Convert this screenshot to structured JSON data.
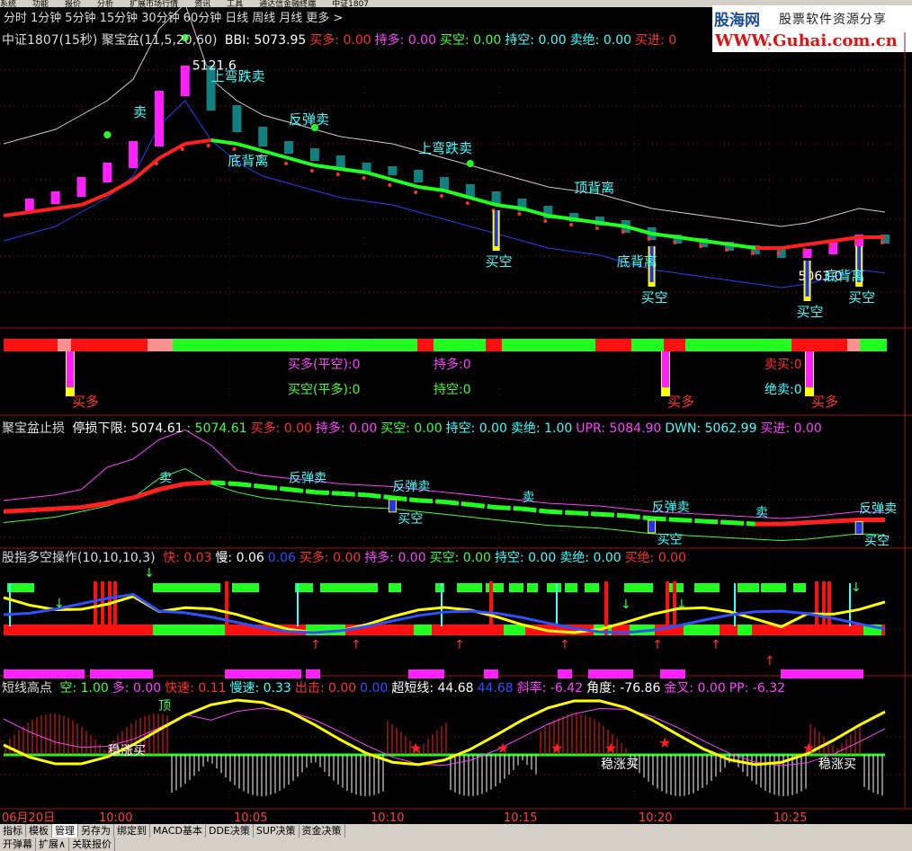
{
  "menu": [
    "系统",
    "功能",
    "报价",
    "分析",
    "扩展市场行情",
    "资讯",
    "工具",
    "通达信金融终端",
    "中证1807"
  ],
  "timeframes": [
    "分时",
    "1分钟",
    "5分钟",
    "15分钟",
    "30分钟",
    "60分钟",
    "日线",
    "周线",
    "月线",
    "更多 >"
  ],
  "logo": {
    "line1": "股海网",
    "line1b": "股票软件资源分享",
    "line2": "WWW.Guhai.com.cn"
  },
  "panel1": {
    "title": "中证1807(15秒) 聚宝盆(11,5,20,60)",
    "fields": [
      {
        "label": "BBI:",
        "value": "5073.95",
        "color": "#ffffff"
      },
      {
        "label": "买多:",
        "value": "0.00",
        "color": "#ff3030"
      },
      {
        "label": "持多:",
        "value": "0.00",
        "color": "#ff40ff"
      },
      {
        "label": "买空:",
        "value": "0.00",
        "color": "#40ff40"
      },
      {
        "label": "持空:",
        "value": "0.00",
        "color": "#40ffff"
      },
      {
        "label": "卖绝:",
        "value": "0.00",
        "color": "#40ffff"
      },
      {
        "label": "买进:",
        "value": "0",
        "color": "#ff3030"
      }
    ],
    "high_label": "5121.6",
    "low_label": "5063.0"
  },
  "panel2": {
    "texts": {
      "buy_long": "买多(平空):0",
      "hold_long": "持多:0",
      "sell_buy": "卖买:0",
      "buy_short": "买空(平多):0",
      "hold_short": "持空:0",
      "sell_sell": "绝卖:0"
    },
    "labels": [
      "买多",
      "买多",
      "买多"
    ]
  },
  "panel3": {
    "title": "聚宝盆止损",
    "fields": [
      {
        "label": "停损下限:",
        "value": "5074.61",
        "color": "#ffffff"
      },
      {
        "label": ":",
        "value": "5074.61",
        "color": "#40ff40"
      },
      {
        "label": "买多:",
        "value": "0.00",
        "color": "#ff3030"
      },
      {
        "label": "持多:",
        "value": "0.00",
        "color": "#ff40ff"
      },
      {
        "label": "买空:",
        "value": "0.00",
        "color": "#40ff40"
      },
      {
        "label": "持空:",
        "value": "0.00",
        "color": "#40ffff"
      },
      {
        "label": "卖绝:",
        "value": "1.00",
        "color": "#40ffff"
      },
      {
        "label": "UPR:",
        "value": "5084.90",
        "color": "#ff40ff"
      },
      {
        "label": "DWN:",
        "value": "5062.99",
        "color": "#40ffff"
      },
      {
        "label": "买进:",
        "value": "0.00",
        "color": "#ff40ff"
      }
    ]
  },
  "panel4": {
    "title": "股指多空操作(10,10,10,3)",
    "fields": [
      {
        "label": "快:",
        "value": "0.03",
        "color": "#ff3030"
      },
      {
        "label": "慢:",
        "value": "0.06",
        "color": "#ffffff"
      },
      {
        "label": "",
        "value": "0.06",
        "color": "#3050ff"
      },
      {
        "label": "买多:",
        "value": "0.00",
        "color": "#ff3030"
      },
      {
        "label": "持多:",
        "value": "0.00",
        "color": "#ff40ff"
      },
      {
        "label": "买空:",
        "value": "0.00",
        "color": "#40ff40"
      },
      {
        "label": "持空:",
        "value": "0.00",
        "color": "#40ffff"
      },
      {
        "label": "卖绝:",
        "value": "0.00",
        "color": "#40ffff"
      },
      {
        "label": "买绝:",
        "value": "0.00",
        "color": "#ff3030"
      }
    ]
  },
  "panel5": {
    "title": "短线高点",
    "fields": [
      {
        "label": "空:",
        "value": "1.00",
        "color": "#40ff40"
      },
      {
        "label": "多:",
        "value": "0.00",
        "color": "#ff40ff"
      },
      {
        "label": "快速:",
        "value": "0.11",
        "color": "#ff3030"
      },
      {
        "label": "慢速:",
        "value": "0.33",
        "color": "#40ffff"
      },
      {
        "label": "出击:",
        "value": "0.00",
        "color": "#ff3030"
      },
      {
        "label": "",
        "value": "0.00",
        "color": "#3050ff"
      },
      {
        "label": "超短线:",
        "value": "44.68",
        "color": "#ffffff"
      },
      {
        "label": "",
        "value": "44.68",
        "color": "#3050ff"
      },
      {
        "label": "斜率:",
        "value": "-6.42",
        "color": "#ff40ff"
      },
      {
        "label": "角度:",
        "value": "-76.86",
        "color": "#ffffff"
      },
      {
        "label": "金叉:",
        "value": "0.00",
        "color": "#ff40ff"
      },
      {
        "label": "PP:",
        "value": "-6.32",
        "color": "#ff40ff"
      }
    ],
    "labels": {
      "top": "顶",
      "steady": "稳涨买"
    }
  },
  "time_axis": [
    "06月20日",
    "10:00",
    "10:05",
    "10:10",
    "10:15",
    "10:20",
    "10:25"
  ],
  "tabs": [
    "指标",
    "模板",
    "管理",
    "另存为",
    "绑定到",
    "MACD基本",
    "DDE决策",
    "SUP决策",
    "资金决策"
  ],
  "bottom_tabs": [
    "开弹幕",
    "扩展∧",
    "关联报价"
  ],
  "chart_data": [
    {
      "type": "line",
      "title": "中证1807(15秒) 聚宝盆(11,5,20,60)",
      "note_labels": [
        "卖",
        "上弯跌卖",
        "反弹卖",
        "底背离",
        "买空",
        "顶背离",
        "上弯跌卖",
        "反弹卖",
        "卖",
        "买"
      ],
      "series": [
        {
          "name": "price",
          "values": [
            5082,
            5084,
            5086,
            5090,
            5094,
            5100,
            5114,
            5121,
            5110,
            5104,
            5100,
            5098,
            5096,
            5094,
            5093,
            5092,
            5090,
            5088,
            5086,
            5084,
            5082,
            5080,
            5079,
            5078,
            5076,
            5074,
            5073,
            5072,
            5071,
            5070,
            5069,
            5070,
            5072,
            5074,
            5073
          ]
        },
        {
          "name": "BBI",
          "values": [
            5080,
            5081,
            5082,
            5083,
            5086,
            5090,
            5096,
            5100,
            5101,
            5100,
            5098,
            5096,
            5094,
            5093,
            5092,
            5090,
            5088,
            5087,
            5085,
            5083,
            5082,
            5080,
            5079,
            5078,
            5077,
            5075,
            5074,
            5073,
            5072,
            5071,
            5071,
            5072,
            5073,
            5074,
            5074
          ]
        }
      ],
      "high": 5121.6,
      "low": 5063.0
    },
    {
      "type": "line",
      "title": "聚宝盆止损",
      "fields": {
        "停损下限": 5074.61,
        "UPR": 5084.9,
        "DWN": 5062.99
      }
    },
    {
      "type": "line",
      "title": "股指多空操作(10,10,10,3)",
      "fields": {
        "快": 0.03,
        "慢": 0.06
      }
    },
    {
      "type": "bar",
      "title": "短线高点",
      "fields": {
        "超短线": 44.68,
        "斜率": -6.42,
        "角度": -76.86,
        "PP": -6.32
      }
    }
  ]
}
